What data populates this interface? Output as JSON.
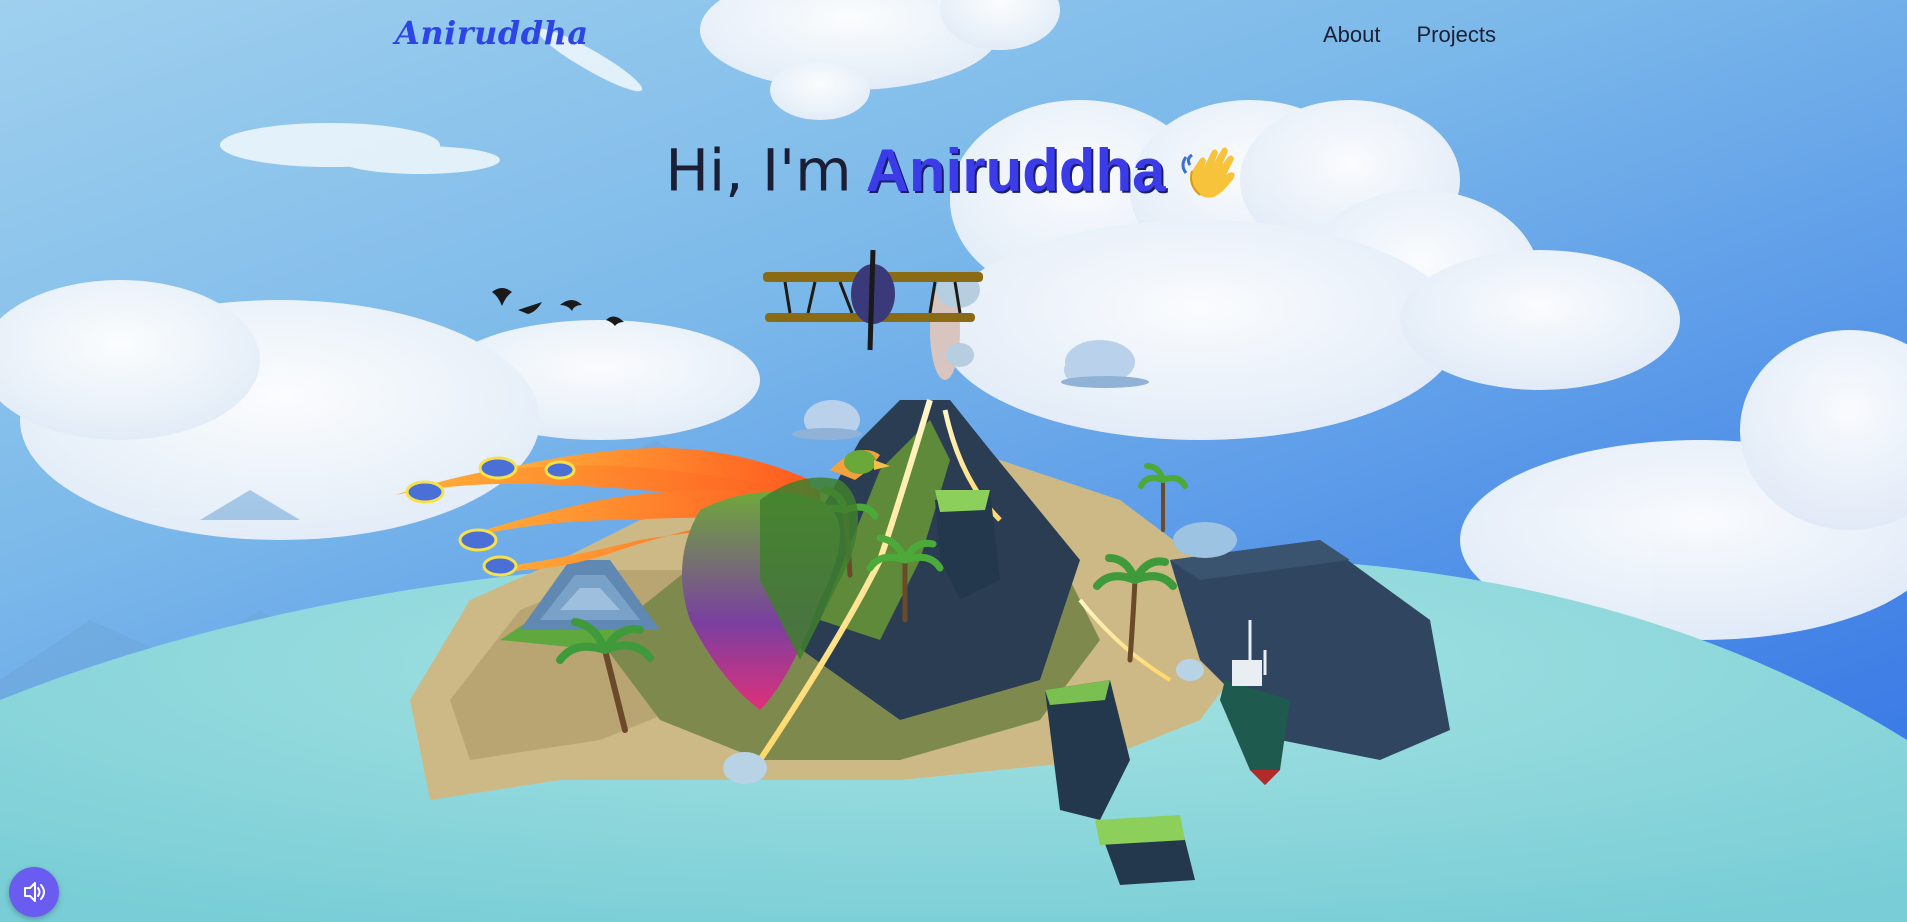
{
  "nav": {
    "logo": "Aniruddha",
    "links": [
      {
        "label": "About"
      },
      {
        "label": "Projects"
      }
    ]
  },
  "hero": {
    "greeting": "Hi, I'm",
    "name": "Aniruddha"
  },
  "icons": {
    "wave": "waving-hand-icon",
    "sound": "speaker-icon"
  },
  "colors": {
    "accent": "#3b3ce8",
    "logo": "#2d44e6",
    "sound_button": "#6a5cf0",
    "sky": "#7cb9ea",
    "sea": "#8ed8dc"
  }
}
